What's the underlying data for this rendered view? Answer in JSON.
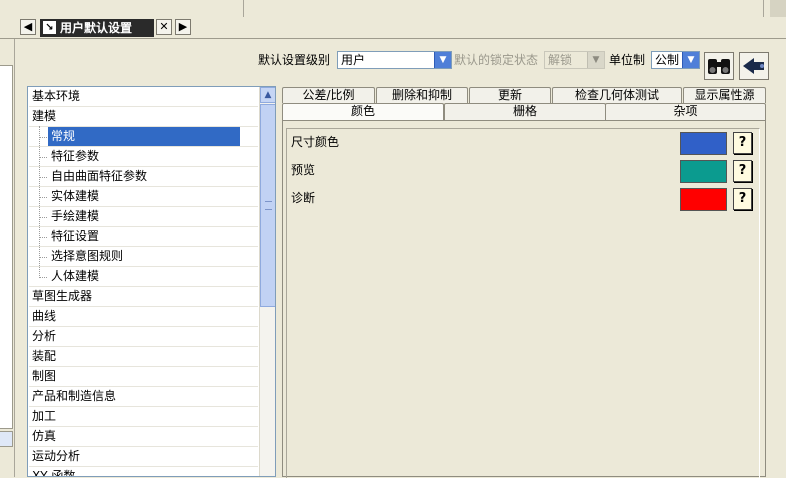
{
  "window": {
    "tab_title": "用户默认设置",
    "nav_back_icon": "chevron-left-icon",
    "nav_forward_icon": "chevron-right-icon",
    "pin_icon": "pin-icon",
    "close_icon": "close-icon"
  },
  "toolbar": {
    "level_label": "默认设置级别",
    "level_value": "用户",
    "lock_label": "默认的锁定状态",
    "lock_value": "解锁",
    "unit_label": "单位制",
    "unit_value": "公制",
    "find_icon": "binoculars-icon",
    "whats_this_icon": "pointer-help-icon"
  },
  "tree": {
    "items": [
      {
        "label": "基本环境",
        "level": 0
      },
      {
        "label": "建模",
        "level": 0
      },
      {
        "label": "常规",
        "level": 1,
        "selected": true
      },
      {
        "label": "特征参数",
        "level": 1
      },
      {
        "label": "自由曲面特征参数",
        "level": 1
      },
      {
        "label": "实体建模",
        "level": 1
      },
      {
        "label": "手绘建模",
        "level": 1
      },
      {
        "label": "特征设置",
        "level": 1
      },
      {
        "label": "选择意图规则",
        "level": 1
      },
      {
        "label": "人体建模",
        "level": 1
      },
      {
        "label": "草图生成器",
        "level": 0
      },
      {
        "label": "曲线",
        "level": 0
      },
      {
        "label": "分析",
        "level": 0
      },
      {
        "label": "装配",
        "level": 0
      },
      {
        "label": "制图",
        "level": 0
      },
      {
        "label": "产品和制造信息",
        "level": 0
      },
      {
        "label": "加工",
        "level": 0
      },
      {
        "label": "仿真",
        "level": 0
      },
      {
        "label": "运动分析",
        "level": 0
      },
      {
        "label": "XY 函数",
        "level": 0
      }
    ]
  },
  "tabs": {
    "row_back": [
      "公差/比例",
      "删除和抑制",
      "更新",
      "检查几何体测试",
      "显示属性源"
    ],
    "row_front": [
      "颜色",
      "栅格",
      "杂项"
    ],
    "active": "颜色"
  },
  "colors_panel": {
    "rows": [
      {
        "label": "尺寸颜色",
        "color": "#3060c8"
      },
      {
        "label": "预览",
        "color": "#0b9b8f"
      },
      {
        "label": "诊断",
        "color": "#ff0000"
      }
    ],
    "help_icon": "question-mark-icon"
  }
}
